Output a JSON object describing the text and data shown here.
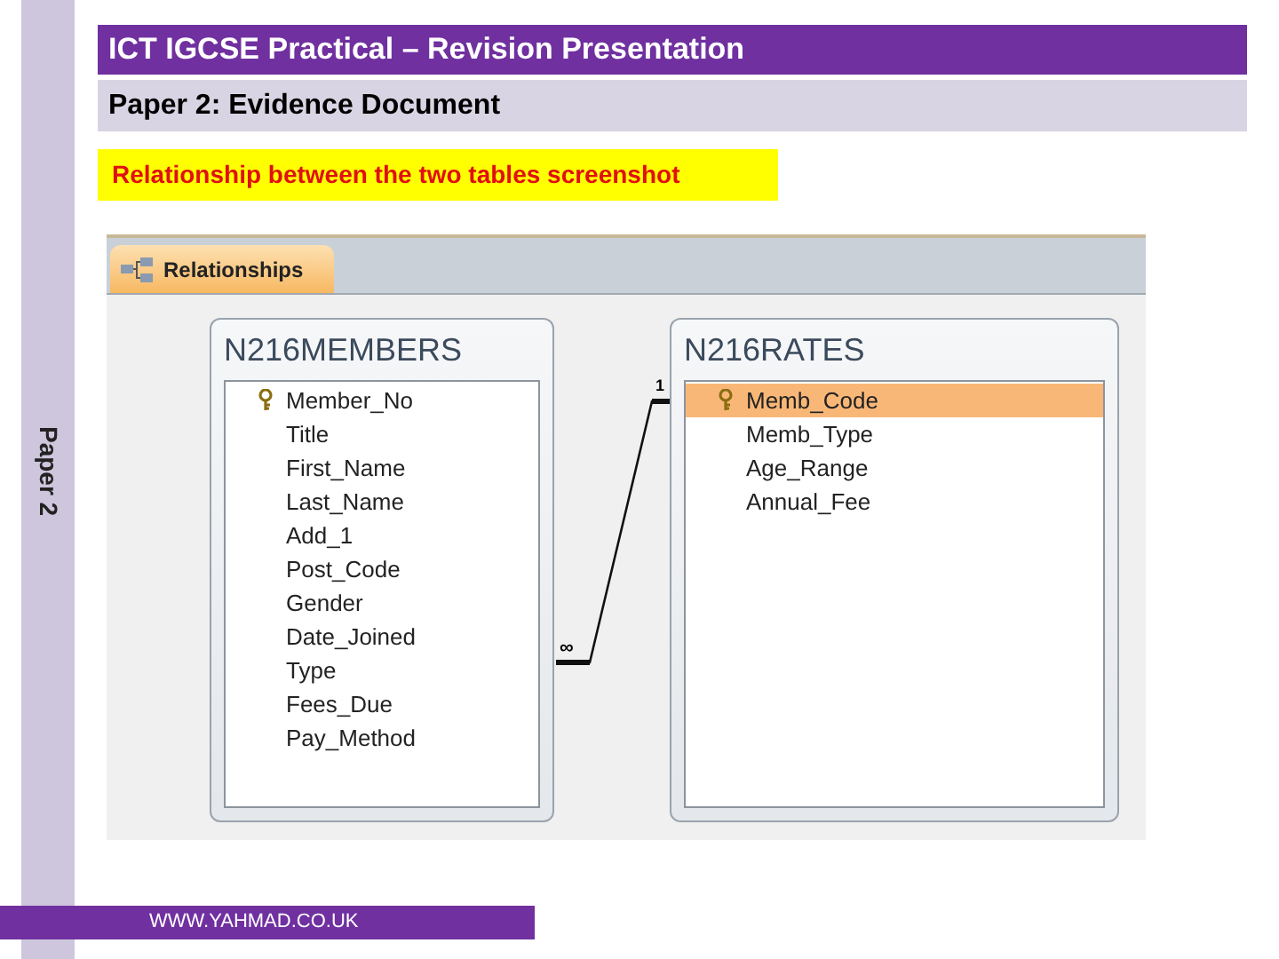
{
  "side_label": "Paper 2",
  "header": {
    "title": "ICT IGCSE Practical – Revision Presentation",
    "subtitle": "Paper 2: Evidence Document"
  },
  "caption": "Relationship between the two tables screenshot",
  "relationships_window": {
    "tab": {
      "label": "Relationships",
      "selected": true
    },
    "tables": [
      {
        "name": "N216MEMBERS",
        "fields": [
          {
            "name": "Member_No",
            "primary_key": true,
            "selected": false
          },
          {
            "name": "Title",
            "primary_key": false,
            "selected": false
          },
          {
            "name": "First_Name",
            "primary_key": false,
            "selected": false
          },
          {
            "name": "Last_Name",
            "primary_key": false,
            "selected": false
          },
          {
            "name": "Add_1",
            "primary_key": false,
            "selected": false
          },
          {
            "name": "Post_Code",
            "primary_key": false,
            "selected": false
          },
          {
            "name": "Gender",
            "primary_key": false,
            "selected": false
          },
          {
            "name": "Date_Joined",
            "primary_key": false,
            "selected": false
          },
          {
            "name": "Type",
            "primary_key": false,
            "selected": false
          },
          {
            "name": "Fees_Due",
            "primary_key": false,
            "selected": false
          },
          {
            "name": "Pay_Method",
            "primary_key": false,
            "selected": false
          }
        ]
      },
      {
        "name": "N216RATES",
        "fields": [
          {
            "name": "Memb_Code",
            "primary_key": true,
            "selected": true
          },
          {
            "name": "Memb_Type",
            "primary_key": false,
            "selected": false
          },
          {
            "name": "Age_Range",
            "primary_key": false,
            "selected": false
          },
          {
            "name": "Annual_Fee",
            "primary_key": false,
            "selected": false
          }
        ]
      }
    ],
    "relationship": {
      "one_label": "1",
      "many_label": "∞"
    }
  },
  "footer": "WWW.YAHMAD.CO.UK"
}
